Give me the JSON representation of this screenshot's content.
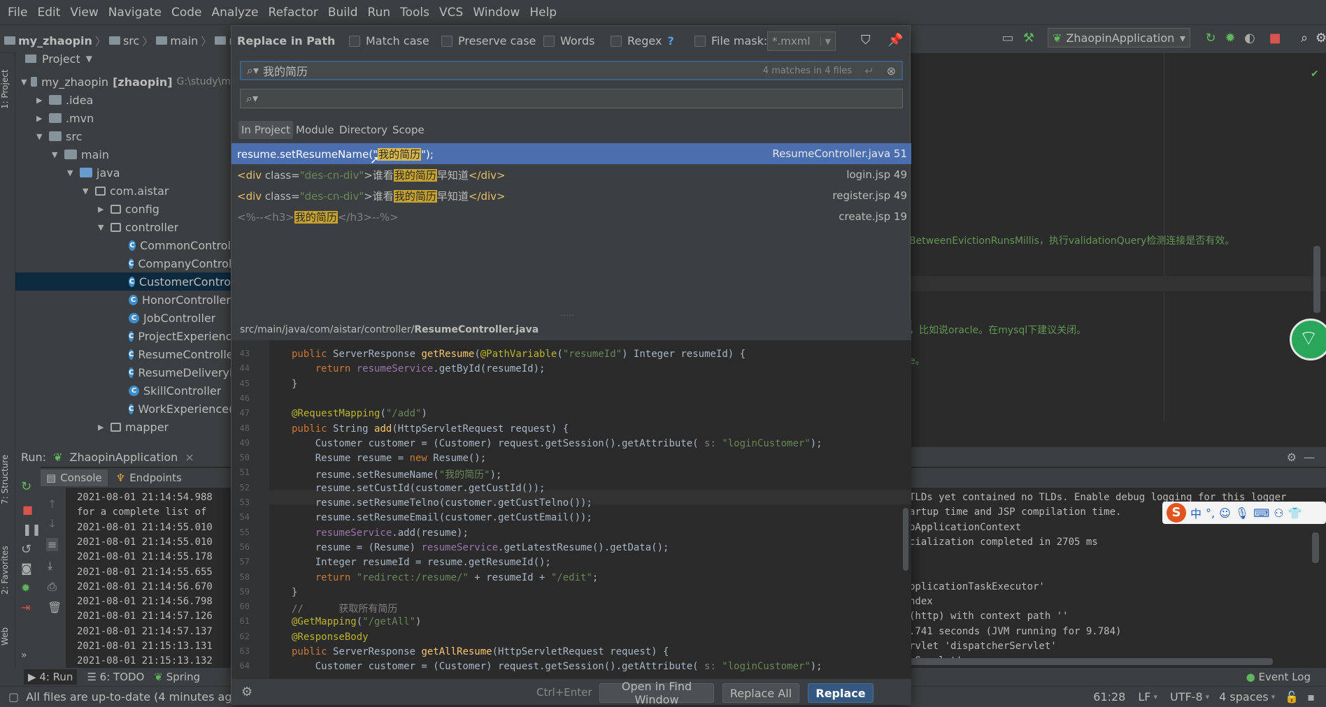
{
  "menu": [
    "File",
    "Edit",
    "View",
    "Navigate",
    "Code",
    "Analyze",
    "Refactor",
    "Build",
    "Run",
    "Tools",
    "VCS",
    "Window",
    "Help"
  ],
  "breadcrumb": [
    "my_zhaopin",
    "src",
    "main",
    "res"
  ],
  "run_config": "ZhaopinApplication",
  "project_panel": {
    "title": "Project",
    "root_name": "my_zhaopin",
    "root_module": "[zhaopin]",
    "root_path": "G:\\study\\m",
    "nodes": [
      ".idea",
      ".mvn",
      "src",
      "main",
      "java",
      "com.aistar",
      "config",
      "controller",
      "CommonControl",
      "CompanyControl",
      "CustomerContro",
      "HonorController",
      "JobController",
      "ProjectExperienc",
      "ResumeControlle",
      "ResumeDeliveryF",
      "SkillController",
      "WorkExperience(",
      "mapper"
    ]
  },
  "left_tabs": {
    "project": "1: Project",
    "structure": "7: Structure",
    "favorites": "2: Favorites",
    "web": "Web"
  },
  "dialog": {
    "title": "Replace in Path",
    "options": {
      "match_case": "Match case",
      "preserve_case": "Preserve case",
      "words": "Words",
      "regex": "Regex",
      "regex_help": "?",
      "file_mask": "File mask:",
      "file_mask_value": "*.mxml"
    },
    "search_text": "我的简历",
    "matches": "4 matches in 4 files",
    "replace_text": "",
    "scopes": [
      "In Project",
      "Module",
      "Directory",
      "Scope"
    ],
    "results": [
      {
        "pre": "resume.setResumeName(\"",
        "hl": "我的简历",
        "post": "\");",
        "file": "ResumeController.java 51"
      },
      {
        "pre_tag": "<div ",
        "pre_attr": "class=",
        "pre_val": "\"des-cn-div\"",
        "pre_end": ">谁看",
        "hl": "我的简历",
        "post": "早知道",
        "post_tag": "</div>",
        "file": "login.jsp 49"
      },
      {
        "pre_tag": "<div ",
        "pre_attr": "class=",
        "pre_val": "\"des-cn-div\"",
        "pre_end": ">谁看",
        "hl": "我的简历",
        "post": "早知道",
        "post_tag": "</div>",
        "file": "register.jsp 49"
      },
      {
        "pre": "<%--<h3>",
        "hl": "我的简历",
        "post": "</h3>--%>",
        "file": "create.jsp 19"
      }
    ],
    "preview_path_prefix": "src/main/java/com/aistar/controller/",
    "preview_path_file": "ResumeController.java",
    "line_numbers": [
      "43",
      "44",
      "45",
      "46",
      "47",
      "48",
      "49",
      "50",
      "51",
      "52",
      "53",
      "54",
      "55",
      "56",
      "57",
      "58",
      "59",
      "60",
      "61",
      "62",
      "63",
      "64"
    ],
    "shortcut": "Ctrl+Enter",
    "btn_open": "Open in Find Window",
    "btn_replace_all": "Replace All",
    "btn_replace": "Replace"
  },
  "code": [
    [
      "kw:public ",
      "pl:ServerResponse ",
      "fn:getResume",
      "pl:(",
      "ann:@PathVariable",
      "pl:(",
      "str:\"resumeId\"",
      "pl:) Integer resumeId) {"
    ],
    [
      "kw:    return ",
      "fld:resumeService",
      "pl:.getById(resumeId);"
    ],
    [
      "pl:}"
    ],
    [
      "pl:"
    ],
    [
      "ann:@RequestMapping",
      "pl:(",
      "str:\"/add\"",
      "pl:)"
    ],
    [
      "kw:public ",
      "pl:String ",
      "fn:add",
      "pl:(HttpServletRequest request) {"
    ],
    [
      "pl:    Customer customer = (Customer) request.getSession().getAttribute(",
      "cmt: s: ",
      "str:\"loginCustomer\"",
      "pl:);"
    ],
    [
      "pl:    Resume resume = ",
      "kw:new ",
      "pl:Resume();"
    ],
    [
      "pl:    resume.setResumeName(",
      "str:\"我的简历\"",
      "pl:);"
    ],
    [
      "pl:    resume.setCustId(customer.getCustId());"
    ],
    [
      "pl:    resume.setResumeTelno(customer.getCustTelno());"
    ],
    [
      "pl:    resume.setResumeEmail(customer.getCustEmail());"
    ],
    [
      "fld:    resumeService",
      "pl:.add(resume);"
    ],
    [
      "pl:    resume = (Resume) ",
      "fld:resumeService",
      "pl:.getLatestResume().getData();"
    ],
    [
      "pl:    Integer resumeId = resume.getResumeId();"
    ],
    [
      "kw:    return ",
      "str:\"redirect:/resume/\" ",
      "pl:+ resumeId + ",
      "str:\"/edit\"",
      "pl:;"
    ],
    [
      "pl:}"
    ],
    [
      "cmt://      获取所有简历"
    ],
    [
      "ann:@GetMapping",
      "pl:(",
      "str:\"/getAll\"",
      "pl:)"
    ],
    [
      "ann:@ResponseBody"
    ],
    [
      "kw:public ",
      "pl:ServerResponse ",
      "fn:getAllResume",
      "pl:(HttpServletRequest request) {"
    ],
    [
      "pl:    Customer customer = (Customer) request.getSession().getAttribute(",
      "cmt: s: ",
      "str:\"loginCustomer\"",
      "pl:);"
    ]
  ],
  "editor_right_comments": [
    "BetweenEvictionRunsMillis，执行validationQuery检测连接是否有效。",
    "，比如说oracle。在mysql下建议关闭。",
    "e。"
  ],
  "run_panel": {
    "label": "Run:",
    "app": "ZhaopinApplication",
    "tabs": [
      "Console",
      "Endpoints"
    ],
    "log_left": [
      "2021-08-01 21:14:54.988",
      " for a complete list of",
      "2021-08-01 21:14:55.010",
      "2021-08-01 21:14:55.010",
      "2021-08-01 21:14:55.178",
      "2021-08-01 21:14:55.655",
      "2021-08-01 21:14:56.670",
      "2021-08-01 21:14:56.798",
      "2021-08-01 21:14:57.126",
      "2021-08-01 21:14:57.137",
      "2021-08-01 21:15:13.131",
      "2021-08-01 21:15:13.132"
    ],
    "log_right": [
      "TLDs yet contained no TLDs. Enable debug logging for this logger",
      "artup time and JSP compilation time.",
      "pApplicationContext",
      "cialization completed in 2705 ms",
      "",
      "",
      "pplicationTaskExecutor'",
      "ndex",
      " (http) with context path ''",
      ".741 seconds (JVM running for 9.784)",
      "rvlet 'dispatcherServlet'",
      "rServlet'"
    ]
  },
  "bottom_tabs": [
    "4: Run",
    "6: TODO",
    "Spring"
  ],
  "event_log": "Event Log",
  "status": {
    "message": "All files are up-to-date (4 minutes ago)",
    "position": "61:28",
    "line_sep": "LF",
    "encoding": "UTF-8",
    "indent": "4 spaces"
  },
  "ime": {
    "mode": "中"
  }
}
